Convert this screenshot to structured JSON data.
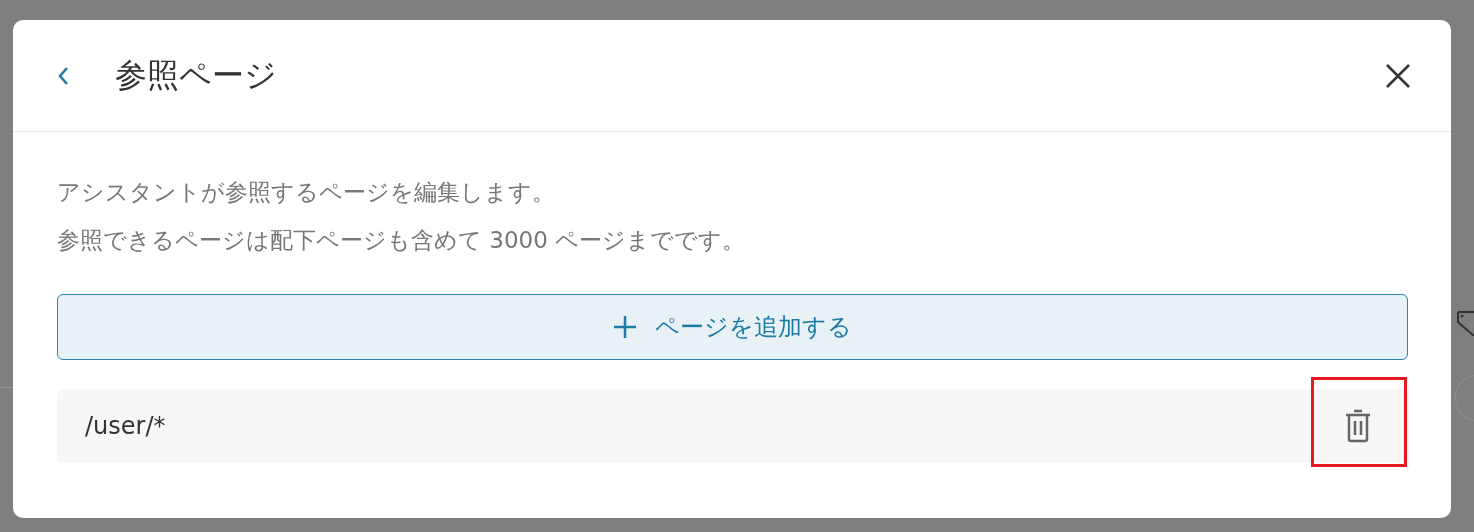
{
  "dialog": {
    "title": "参照ページ",
    "description": [
      "アシスタントが参照するページを編集します。",
      "参照できるページは配下ページも含めて 3000 ページまでです。"
    ],
    "add_button": "ページを追加する",
    "pages": [
      {
        "path": "/user/*",
        "highlighted": true
      }
    ]
  }
}
